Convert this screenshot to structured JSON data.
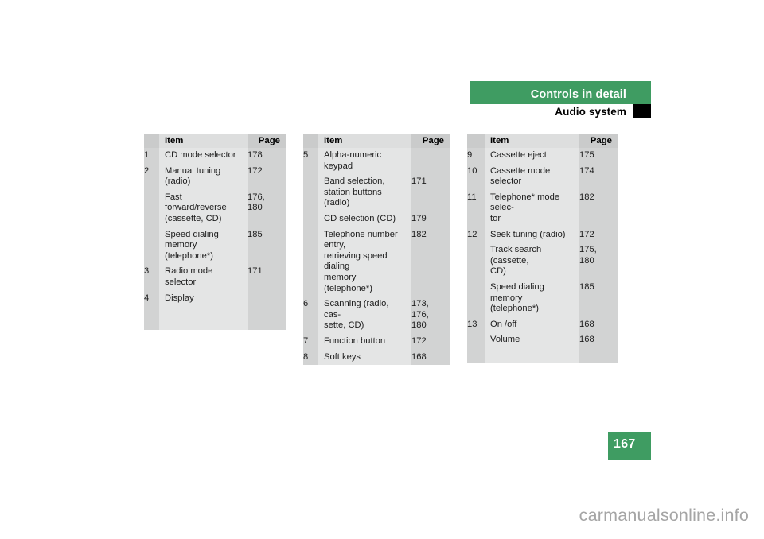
{
  "header": {
    "chapter_title": "Controls in detail",
    "section_title": "Audio system",
    "chapter_bar_color": "#3f9c62",
    "marker_color": "#000000"
  },
  "page_footer": {
    "page_number": "167",
    "block_color": "#3f9c62"
  },
  "watermark": {
    "text": "carmanualsonline.info",
    "color": "#a5a5a5"
  },
  "tables": [
    {
      "name": "audio-controls-table-1",
      "columns": [
        "Item",
        "Page"
      ],
      "rows": [
        {
          "num": "1",
          "item": "CD mode selector",
          "page": "178"
        },
        {
          "num": "2",
          "item": "Manual tuning\n(radio)",
          "page": "172"
        },
        {
          "num": "",
          "item": "Fast forward/reverse\n(cassette, CD)",
          "page": "176,\n180"
        },
        {
          "num": "",
          "item": "Speed dialing memory\n(telephone*)",
          "page": "185"
        },
        {
          "num": "3",
          "item": "Radio mode selector",
          "page": "171"
        },
        {
          "num": "4",
          "item": "Display",
          "page": ""
        }
      ]
    },
    {
      "name": "audio-controls-table-2",
      "columns": [
        "Item",
        "Page"
      ],
      "rows": [
        {
          "num": "5",
          "item": "Alpha-numeric keypad",
          "page": ""
        },
        {
          "num": "",
          "item": "Band selection,\nstation buttons (radio)",
          "page": "171"
        },
        {
          "num": "",
          "item": "CD selection (CD)",
          "page": "179"
        },
        {
          "num": "",
          "item": "Telephone number entry,\nretrieving speed dialing\nmemory (telephone*)",
          "page": "182"
        },
        {
          "num": "6",
          "item": "Scanning (radio, cas-\nsette, CD)",
          "page": "173,\n176,\n180"
        },
        {
          "num": "7",
          "item": "Function button",
          "page": "172"
        },
        {
          "num": "8",
          "item": "Soft keys",
          "page": "168"
        }
      ]
    },
    {
      "name": "audio-controls-table-3",
      "columns": [
        "Item",
        "Page"
      ],
      "rows": [
        {
          "num": "9",
          "item": "Cassette eject",
          "page": "175"
        },
        {
          "num": "10",
          "item": "Cassette mode selector",
          "page": "174"
        },
        {
          "num": "11",
          "item": "Telephone* mode selec-\ntor",
          "page": "182"
        },
        {
          "num": "12",
          "item": "Seek tuning (radio)",
          "page": "172"
        },
        {
          "num": "",
          "item": "Track search (cassette,\nCD)",
          "page": "175,\n180"
        },
        {
          "num": "",
          "item": "Speed dialing memory\n(telephone*)",
          "page": "185"
        },
        {
          "num": "13",
          "item": "On /off",
          "page": "168"
        },
        {
          "num": "",
          "item": "Volume",
          "page": "168"
        }
      ]
    }
  ]
}
